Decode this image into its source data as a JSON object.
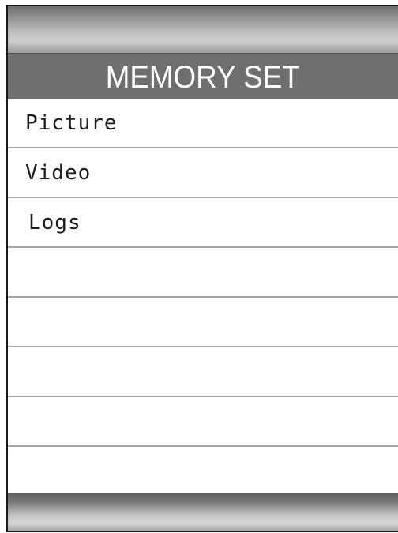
{
  "header": {
    "title": "MEMORY SET"
  },
  "menu": {
    "items": [
      {
        "label": "Picture"
      },
      {
        "label": "Video"
      },
      {
        "label": "Logs"
      },
      {
        "label": ""
      },
      {
        "label": ""
      },
      {
        "label": ""
      },
      {
        "label": ""
      },
      {
        "label": ""
      }
    ]
  },
  "colors": {
    "title_bar": "#6f6f6f",
    "title_text": "#ffffff",
    "row_divider": "#a6a6a6",
    "background": "#ffffff"
  }
}
